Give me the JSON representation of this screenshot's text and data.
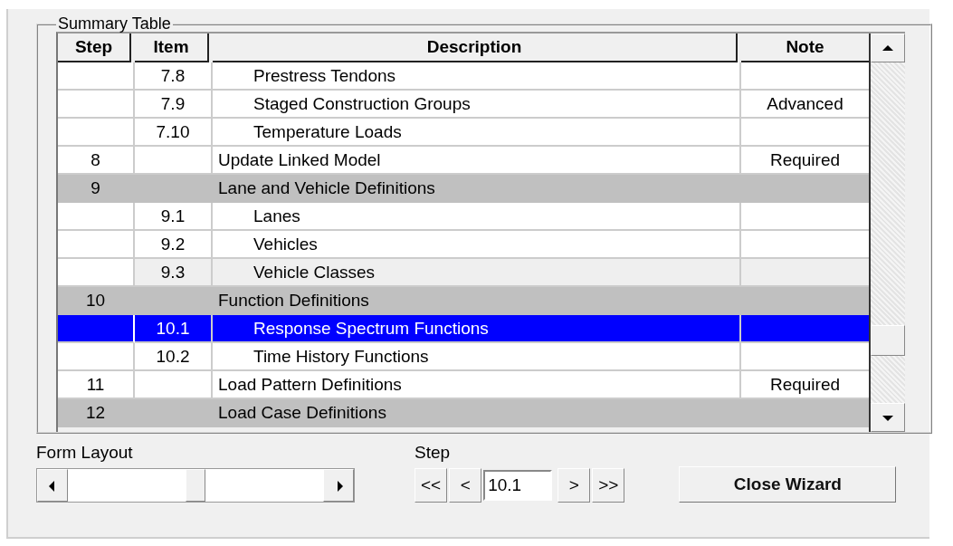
{
  "summary_table": {
    "title": "Summary Table",
    "columns": [
      "Step",
      "Item",
      "Description",
      "Note"
    ],
    "rows": [
      {
        "kind": "item",
        "step": "",
        "item": "7.8",
        "description": "Prestress Tendons",
        "note": "",
        "selected": false,
        "shaded": false
      },
      {
        "kind": "item",
        "step": "",
        "item": "7.9",
        "description": "Staged Construction Groups",
        "note": "Advanced",
        "selected": false,
        "shaded": false
      },
      {
        "kind": "item",
        "step": "",
        "item": "7.10",
        "description": "Temperature Loads",
        "note": "",
        "selected": false,
        "shaded": false
      },
      {
        "kind": "step",
        "step": "8",
        "item": "",
        "description": "Update Linked Model",
        "note": "Required",
        "selected": false,
        "shaded": false
      },
      {
        "kind": "step",
        "step": "9",
        "item": "",
        "description": "Lane and Vehicle Definitions",
        "note": "",
        "selected": false,
        "shaded": true
      },
      {
        "kind": "item",
        "step": "",
        "item": "9.1",
        "description": "Lanes",
        "note": "",
        "selected": false,
        "shaded": false
      },
      {
        "kind": "item",
        "step": "",
        "item": "9.2",
        "description": "Vehicles",
        "note": "",
        "selected": false,
        "shaded": false
      },
      {
        "kind": "item",
        "step": "",
        "item": "9.3",
        "description": "Vehicle Classes",
        "note": "",
        "selected": false,
        "shaded": true
      },
      {
        "kind": "step",
        "step": "10",
        "item": "",
        "description": "Function Definitions",
        "note": "",
        "selected": false,
        "shaded": true
      },
      {
        "kind": "item",
        "step": "",
        "item": "10.1",
        "description": "Response Spectrum Functions",
        "note": "",
        "selected": true,
        "shaded": false
      },
      {
        "kind": "item",
        "step": "",
        "item": "10.2",
        "description": "Time History Functions",
        "note": "",
        "selected": false,
        "shaded": false
      },
      {
        "kind": "step",
        "step": "11",
        "item": "",
        "description": "Load Pattern Definitions",
        "note": "Required",
        "selected": false,
        "shaded": false
      },
      {
        "kind": "step",
        "step": "12",
        "item": "",
        "description": "Load Case Definitions",
        "note": "",
        "selected": false,
        "shaded": true
      }
    ]
  },
  "form_layout": {
    "label": "Form Layout",
    "level": 0.5
  },
  "step_nav": {
    "label": "Step",
    "first": "<<",
    "previous": "<",
    "value": "10.1",
    "next": ">",
    "last": ">>"
  },
  "close_button": "Close Wizard"
}
